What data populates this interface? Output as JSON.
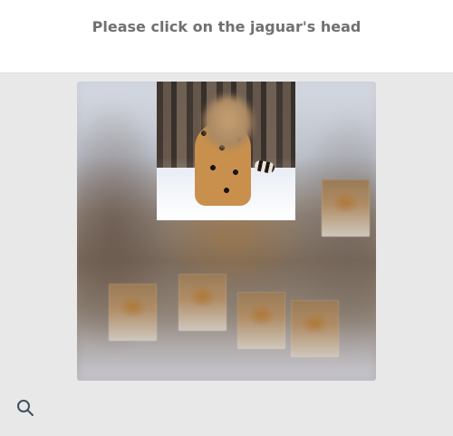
{
  "header": {
    "title": "Please click on the jaguar's head"
  },
  "icons": {
    "search": "search-icon"
  },
  "colors": {
    "title_text": "#707070",
    "panel_bg": "#e8e8e8"
  }
}
